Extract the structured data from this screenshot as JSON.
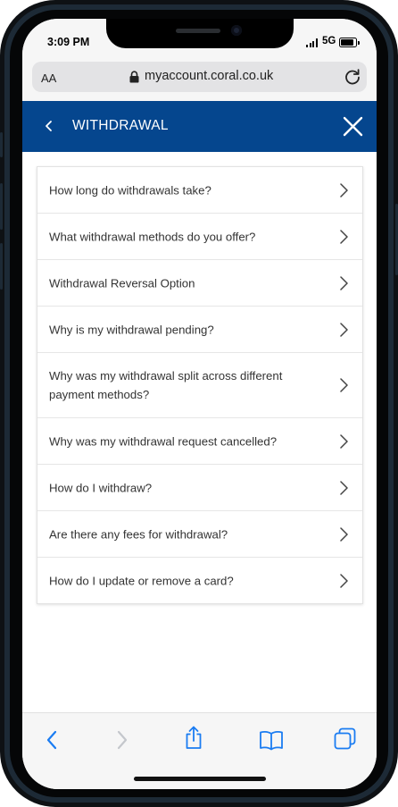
{
  "status_bar": {
    "time": "3:09 PM",
    "network": "5G"
  },
  "browser": {
    "text_size_label": "AA",
    "url": "myaccount.coral.co.uk"
  },
  "header": {
    "title": "WITHDRAWAL",
    "background_color": "#05468e"
  },
  "faq": {
    "items": [
      {
        "label": "How long do withdrawals take?"
      },
      {
        "label": "What withdrawal methods do you offer?"
      },
      {
        "label": "Withdrawal Reversal Option"
      },
      {
        "label": "Why is my withdrawal pending?"
      },
      {
        "label": "Why was my withdrawal split across different payment methods?"
      },
      {
        "label": "Why was my withdrawal request cancelled?"
      },
      {
        "label": "How do I withdraw?"
      },
      {
        "label": "Are there any fees for withdrawal?"
      },
      {
        "label": "How do I update or remove a card?"
      }
    ]
  },
  "toolbar": {
    "icons": [
      "back-icon",
      "forward-icon",
      "share-icon",
      "bookmarks-icon",
      "tabs-icon"
    ],
    "accent_color": "#1a7cf2"
  }
}
